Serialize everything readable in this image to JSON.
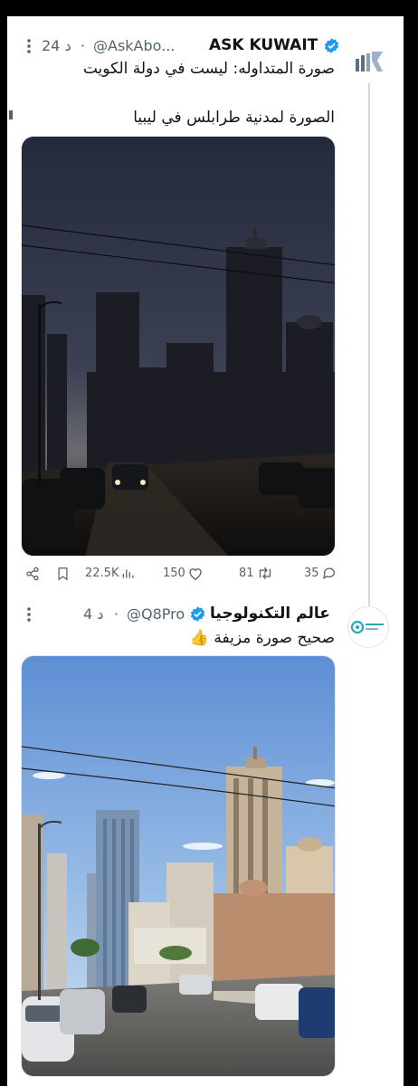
{
  "tweet1": {
    "display_name": "ASK KUWAIT",
    "handle": "@AskAbo...",
    "separator": "·",
    "time": "24 د",
    "line1": "صورة المتداوله: ليست في دولة الكويت",
    "line2": "الصورة لمدنية طرابلس في ليبيا",
    "stats": {
      "views": "22.5K",
      "likes": "150",
      "retweets": "81",
      "replies": "35"
    }
  },
  "tweet2": {
    "display_name": "عالم التكنولوجيا",
    "handle": "@Q8Pro",
    "separator": "·",
    "time": "4 د",
    "line1": "صحيح صورة مزيفة 👍"
  },
  "colors": {
    "verified": "#1d9bf0",
    "muted": "#536471",
    "night_sky": "#272d3c",
    "day_sky": "#7fa6d8"
  },
  "icons": [
    "more-icon",
    "verified-icon",
    "share-icon",
    "bookmark-icon",
    "views-icon",
    "like-icon",
    "retweet-icon",
    "reply-icon"
  ]
}
